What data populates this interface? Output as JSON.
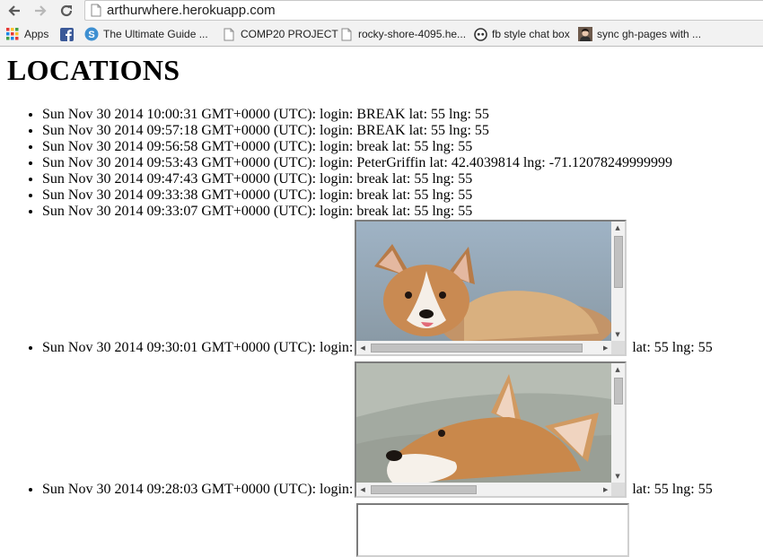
{
  "browser": {
    "url": "arthurwhere.herokuapp.com",
    "nav": {
      "back": "back-arrow-icon",
      "forward": "forward-arrow-icon",
      "reload": "reload-icon"
    },
    "bookmarks": [
      {
        "label": "Apps",
        "icon": "apps-grid-icon"
      },
      {
        "label": "The Ultimate Guide ...",
        "icon": "s-logo-icon"
      },
      {
        "label": "COMP20 PROJECT",
        "icon": "page-icon"
      },
      {
        "label": "rocky-shore-4095.he...",
        "icon": "page-icon"
      },
      {
        "label": "fb style chat box",
        "icon": "github-icon"
      },
      {
        "label": "sync gh-pages with ...",
        "icon": "avatar-icon"
      }
    ],
    "facebook_icon": "facebook-icon"
  },
  "page": {
    "title": "LOCATIONS",
    "entries": [
      {
        "text": "Sun Nov 30 2014 10:00:31 GMT+0000 (UTC): login: BREAK lat: 55 lng: 55"
      },
      {
        "text": "Sun Nov 30 2014 09:57:18 GMT+0000 (UTC): login: BREAK lat: 55 lng: 55"
      },
      {
        "text": "Sun Nov 30 2014 09:56:58 GMT+0000 (UTC): login: break lat: 55 lng: 55"
      },
      {
        "text": "Sun Nov 30 2014 09:53:43 GMT+0000 (UTC): login: PeterGriffin lat: 42.4039814 lng: -71.12078249999999"
      },
      {
        "text": "Sun Nov 30 2014 09:47:43 GMT+0000 (UTC): login: break lat: 55 lng: 55"
      },
      {
        "text": "Sun Nov 30 2014 09:33:38 GMT+0000 (UTC): login: break lat: 55 lng: 55"
      },
      {
        "text": "Sun Nov 30 2014 09:33:07 GMT+0000 (UTC): login: break lat: 55 lng: 55"
      }
    ],
    "frame_entries": [
      {
        "before": "Sun Nov 30 2014 09:30:01 GMT+0000 (UTC): login:",
        "after": "lat: 55 lng: 55",
        "image": "corgi-puppy-image"
      },
      {
        "before": "Sun Nov 30 2014 09:28:03 GMT+0000 (UTC): login:",
        "after": "lat: 55 lng: 55",
        "image": "corgi-ears-image"
      }
    ]
  }
}
